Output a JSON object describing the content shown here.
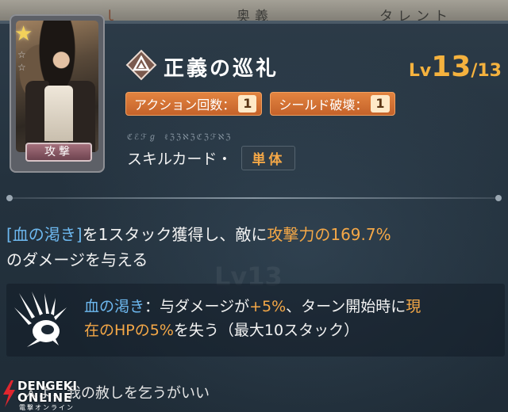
{
  "tabs": [
    {
      "label": "ｌ"
    },
    {
      "label": "奥義"
    },
    {
      "label": "タレント"
    }
  ],
  "card": {
    "label": "攻撃",
    "icon": "star-icon"
  },
  "skill": {
    "name": "正義の巡礼",
    "level_prefix": "Lv",
    "level_current": "13",
    "level_separator": "/",
    "level_max": "13",
    "pills": [
      {
        "label": "アクション回数：",
        "value": "1"
      },
      {
        "label": "シールド破壊：",
        "value": "1"
      }
    ],
    "cipher_text": "ℭℰℱℊ ℓℨℨℵℨℭℨℱℵℨ",
    "type_label": "スキルカード・",
    "type_badge": "単体"
  },
  "description": {
    "p1_bracket": "[血の渇き]",
    "p1_mid": "を1スタック獲得し、敵に",
    "p1_highlight": "攻撃力の169.7%",
    "p2": "のダメージを与える"
  },
  "background_watermark": "Lv13",
  "effect": {
    "icon": "claw-slash-icon",
    "term": "血の渇き",
    "line1_mid": "：与ダメージが",
    "line1_val": "+5%",
    "line1_end": "、ターン開始時に",
    "line1_tail": "現",
    "line2_orange": "在のHPの5%",
    "line2_end": "を失う（最大10スタック）"
  },
  "flavor": "人よ、我の赦しを乞うがいい",
  "logo": {
    "line1": "DENGEKI",
    "line2": "ONLINE",
    "line3": "電撃オンライン"
  },
  "colors": {
    "accent_orange": "#f5a847",
    "accent_blue": "#6db8ef",
    "pill_orange": "#e38440",
    "background": "#24323e"
  }
}
